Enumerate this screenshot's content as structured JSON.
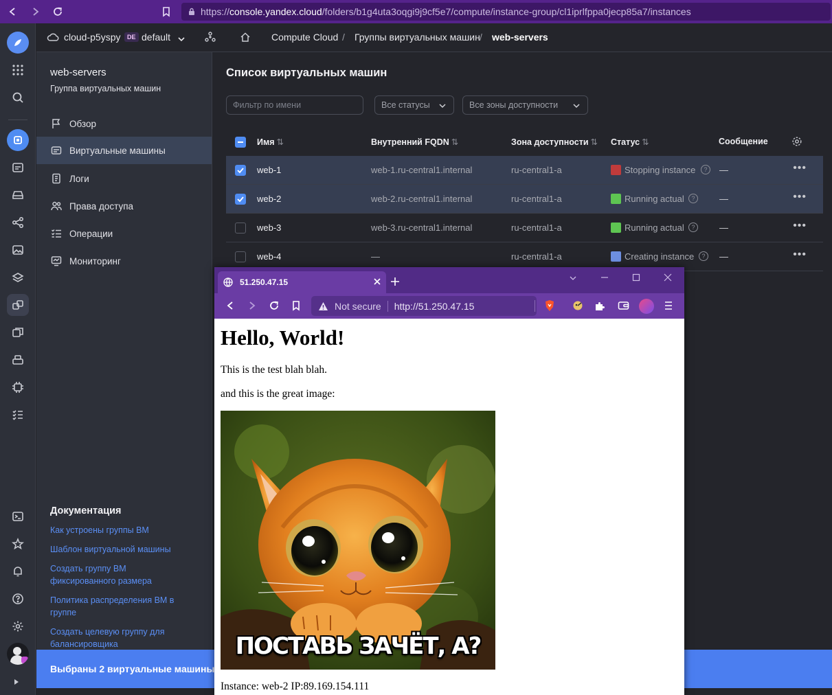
{
  "outer_browser": {
    "url_prefix": "https://",
    "url_host": "console.yandex.cloud",
    "url_path": "/folders/b1g4uta3oqgi9j9cf5e7/compute/instance-group/cl1iprlfppa0jecp85a7/instances"
  },
  "header": {
    "cloud": "cloud-p5yspy",
    "badge": "DE",
    "folder": "default",
    "breadcrumbs": [
      "Compute Cloud",
      "Группы виртуальных машин",
      "web-servers"
    ],
    "separator": "/"
  },
  "sidebar": {
    "title": "web-servers",
    "subtitle": "Группа виртуальных машин",
    "items": [
      {
        "label": "Обзор",
        "icon": "flag-icon"
      },
      {
        "label": "Виртуальные машины",
        "icon": "vm-icon"
      },
      {
        "label": "Логи",
        "icon": "log-icon"
      },
      {
        "label": "Права доступа",
        "icon": "users-icon"
      },
      {
        "label": "Операции",
        "icon": "list-icon"
      },
      {
        "label": "Мониторинг",
        "icon": "monitor-icon"
      }
    ],
    "docs_title": "Документация",
    "docs": [
      "Как устроены группы ВМ",
      "Шаблон виртуальной машины",
      "Создать группу ВМ фиксированного размера",
      "Политика распределения ВМ в группе",
      "Создать целевую группу для балансировщика"
    ]
  },
  "main": {
    "title": "Список виртуальных машин",
    "filter_placeholder": "Фильтр по имени",
    "status_select": "Все статусы",
    "zone_select": "Все зоны доступности",
    "columns": [
      "Имя",
      "Внутренний FQDN",
      "Зона доступности",
      "Статус",
      "Сообщение"
    ],
    "rows": [
      {
        "name": "web-1",
        "fqdn": "web-1.ru-central1.internal",
        "zone": "ru-central1-a",
        "status": "Stopping instance",
        "message": "—",
        "selected": true
      },
      {
        "name": "web-2",
        "fqdn": "web-2.ru-central1.internal",
        "zone": "ru-central1-a",
        "status": "Running actual",
        "message": "—",
        "selected": true
      },
      {
        "name": "web-3",
        "fqdn": "web-3.ru-central1.internal",
        "zone": "ru-central1-a",
        "status": "Running actual",
        "message": "—",
        "selected": false
      },
      {
        "name": "web-4",
        "fqdn": "—",
        "zone": "ru-central1-a",
        "status": "Creating instance",
        "message": "—",
        "selected": false
      }
    ],
    "status_colors": {
      "stopping": "#c03b3b",
      "running": "#5ec552",
      "creating": "#6d8fe0"
    }
  },
  "bottom_bar": {
    "text": "Выбраны 2 виртуальные машины"
  },
  "popup": {
    "tab_title": "51.250.47.15",
    "security": "Not secure",
    "url": "http://51.250.47.15",
    "heading": "Hello, World!",
    "para1": "This is the test blah blah.",
    "para2": "and this is the great image:",
    "image_caption": "ПОСТАВЬ ЗАЧЁТ, А?",
    "footer": "Instance: web-2 IP:89.169.154.111"
  }
}
